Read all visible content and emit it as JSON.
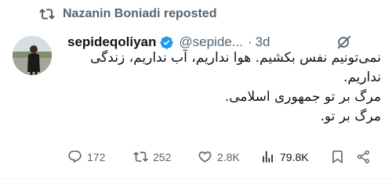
{
  "repost_bar": {
    "text": "Nazanin Boniadi reposted",
    "icon": "repost-icon"
  },
  "tweet": {
    "author": {
      "display_name": "sepideqoliyan",
      "verified": true,
      "handle": "@sepide...",
      "separator": "·",
      "time": "3d"
    },
    "text_lines": [
      "نمی‌تونیم نفس بکشیم. هوا نداریم، آب نداریم، زندگی",
      "نداریم.",
      "مرگ بر تو جمهوری اسلامی.",
      "مرگ بر تو."
    ],
    "actions": {
      "replies": "172",
      "reposts": "252",
      "likes": "2.8K",
      "views": "79.8K"
    }
  },
  "colors": {
    "text_primary": "#0f1419",
    "text_secondary": "#536471",
    "verified_blue": "#1d9bf0",
    "divider": "#eff3f4"
  }
}
